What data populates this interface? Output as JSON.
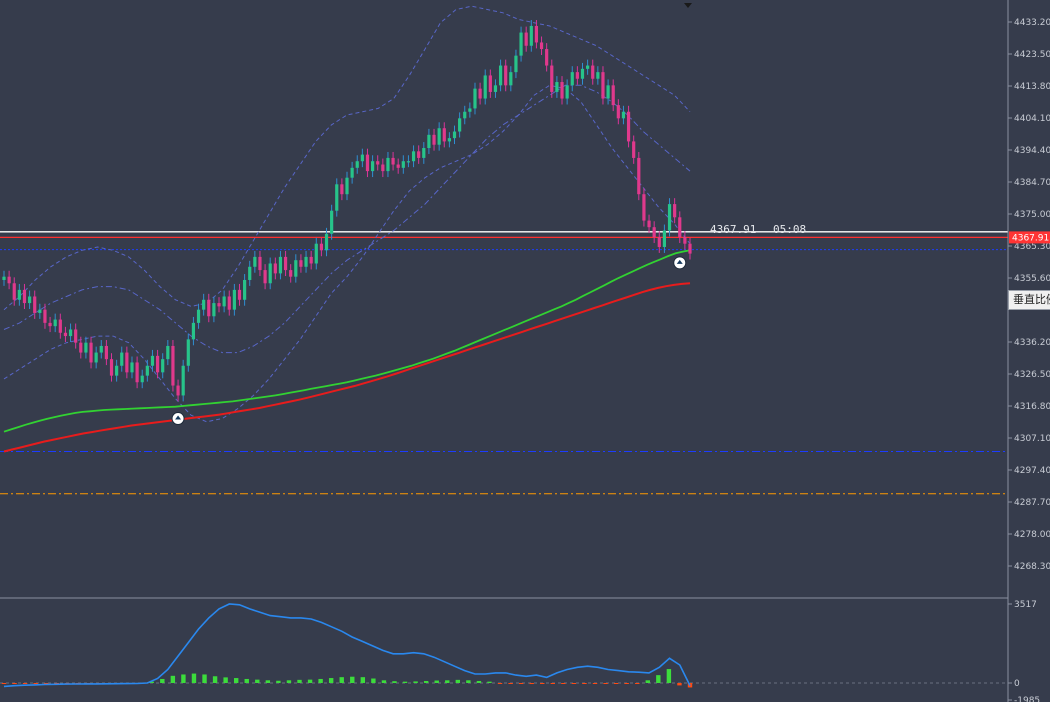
{
  "chart_data": [
    {
      "type": "candlestick",
      "panel": "main",
      "y_axis_ticks": [
        4433.2,
        4423.5,
        4413.8,
        4404.1,
        4394.4,
        4384.7,
        4375.0,
        4365.3,
        4355.6,
        4336.2,
        4326.5,
        4316.8,
        4307.1,
        4297.4,
        4287.7,
        4278.0,
        4268.3
      ],
      "ylim": [
        4262.0,
        4438.0
      ],
      "current_price": "4367.91",
      "current_price_tag": "4367.91",
      "countdown": "05:08",
      "close": [
        4356,
        4354,
        4349,
        4352,
        4348,
        4350,
        4345,
        4346,
        4342,
        4341,
        4343,
        4339,
        4338,
        4340,
        4336,
        4333,
        4336,
        4330,
        4333,
        4335,
        4331,
        4326,
        4329,
        4333,
        4327,
        4330,
        4324,
        4326,
        4329,
        4332,
        4327,
        4331,
        4335,
        4323,
        4320,
        4329,
        4337,
        4342,
        4346,
        4349,
        4344,
        4348,
        4347,
        4350,
        4346,
        4352,
        4349,
        4355,
        4359,
        4362,
        4358,
        4354,
        4360,
        4357,
        4362,
        4358,
        4356,
        4361,
        4359,
        4362,
        4360,
        4366,
        4364,
        4369,
        4376,
        4384,
        4381,
        4386,
        4389,
        4391,
        4393,
        4388,
        4391,
        4390,
        4388,
        4392,
        4390,
        4389,
        4391,
        4391,
        4394,
        4392,
        4395,
        4399,
        4396,
        4401,
        4397,
        4398,
        4400,
        4404,
        4406,
        4407,
        4413,
        4410,
        4417,
        4412,
        4414,
        4420,
        4414,
        4418,
        4423,
        4430,
        4426,
        4432,
        4427,
        4425,
        4420,
        4412,
        4415,
        4410,
        4414,
        4418,
        4416,
        4419,
        4420,
        4416,
        4418,
        4410,
        4414,
        4408,
        4404,
        4406,
        4397,
        4392,
        4381,
        4373,
        4371,
        4368,
        4365,
        4370,
        4378,
        4374,
        4368,
        4366,
        4363
      ],
      "sma_green": [
        4309,
        4309.7,
        4310.4,
        4311.1,
        4311.7,
        4312.3,
        4312.9,
        4313.4,
        4313.9,
        4314.3,
        4314.7,
        4315.0,
        4315.2,
        4315.4,
        4315.6,
        4315.7,
        4315.8,
        4315.9,
        4316.0,
        4316.1,
        4316.2,
        4316.3,
        4316.4,
        4316.5,
        4316.6,
        4316.8,
        4317.0,
        4317.2,
        4317.4,
        4317.6,
        4317.8,
        4318.0,
        4318.2,
        4318.5,
        4318.8,
        4319.1,
        4319.4,
        4319.7,
        4320.0,
        4320.4,
        4320.8,
        4321.2,
        4321.6,
        4322.0,
        4322.4,
        4322.8,
        4323.2,
        4323.6,
        4324.0,
        4324.5,
        4325.0,
        4325.5,
        4326.0,
        4326.6,
        4327.2,
        4327.8,
        4328.4,
        4329.0,
        4329.7,
        4330.4,
        4331.1,
        4331.9,
        4332.7,
        4333.5,
        4334.4,
        4335.3,
        4336.2,
        4337.1,
        4338.0,
        4338.9,
        4339.8,
        4340.7,
        4341.6,
        4342.5,
        4343.4,
        4344.3,
        4345.2,
        4346.1,
        4347.0,
        4348.0,
        4349.0,
        4350.1,
        4351.2,
        4352.3,
        4353.4,
        4354.5,
        4355.6,
        4356.6,
        4357.6,
        4358.6,
        4359.6,
        4360.5,
        4361.4,
        4362.3,
        4363.1,
        4363.6,
        4364.0
      ],
      "sma_red": [
        4303,
        4303.6,
        4304.2,
        4304.8,
        4305.4,
        4306.0,
        4306.5,
        4307.0,
        4307.5,
        4308.0,
        4308.5,
        4308.9,
        4309.3,
        4309.7,
        4310.1,
        4310.5,
        4310.9,
        4311.2,
        4311.5,
        4311.8,
        4312.1,
        4312.4,
        4312.7,
        4313.0,
        4313.3,
        4313.6,
        4313.9,
        4314.2,
        4314.6,
        4315.0,
        4315.4,
        4315.8,
        4316.2,
        4316.7,
        4317.2,
        4317.7,
        4318.2,
        4318.7,
        4319.3,
        4319.9,
        4320.5,
        4321.1,
        4321.7,
        4322.3,
        4322.9,
        4323.6,
        4324.3,
        4325.0,
        4325.7,
        4326.5,
        4327.3,
        4328.1,
        4328.9,
        4329.7,
        4330.5,
        4331.3,
        4332.1,
        4332.9,
        4333.7,
        4334.5,
        4335.3,
        4336.1,
        4336.9,
        4337.7,
        4338.5,
        4339.3,
        4340.1,
        4340.9,
        4341.7,
        4342.5,
        4343.3,
        4344.1,
        4344.9,
        4345.7,
        4346.5,
        4347.3,
        4348.1,
        4348.9,
        4349.7,
        4350.5,
        4351.3,
        4352.0,
        4352.6,
        4353.1,
        4353.5,
        4353.8,
        4354.0
      ],
      "bb_upper": [
        4346,
        4350,
        4355,
        4359,
        4362,
        4364,
        4365,
        4364,
        4362,
        4358,
        4353,
        4349,
        4347,
        4348,
        4352,
        4359,
        4367,
        4375,
        4383,
        4390,
        4397,
        4402,
        4405,
        4406,
        4407,
        4410,
        4417,
        4425,
        4433,
        4437,
        4438,
        4437,
        4436,
        4434,
        4433,
        4432,
        4430,
        4428,
        4426,
        4423,
        4420,
        4417,
        4414,
        4411,
        4406
      ],
      "bb_middle": [
        4340,
        4342,
        4345,
        4348,
        4350,
        4352,
        4353,
        4353,
        4352,
        4349,
        4346,
        4342,
        4338,
        4335,
        4333,
        4333,
        4335,
        4338,
        4342,
        4347,
        4352,
        4357,
        4361,
        4364,
        4367,
        4370,
        4374,
        4378,
        4383,
        4388,
        4393,
        4398,
        4402,
        4405,
        4408,
        4411,
        4414,
        4414,
        4412,
        4409,
        4405,
        4400,
        4396,
        4392,
        4388
      ],
      "bb_lower": [
        4325,
        4328,
        4331,
        4334,
        4336,
        4337,
        4338,
        4338,
        4336,
        4331,
        4325,
        4319,
        4314,
        4312,
        4313,
        4316,
        4320,
        4325,
        4331,
        4337,
        4344,
        4351,
        4356,
        4362,
        4369,
        4376,
        4382,
        4386,
        4389,
        4391,
        4393,
        4396,
        4400,
        4405,
        4411,
        4414,
        4413,
        4409,
        4402,
        4395,
        4389,
        4383,
        4377,
        4372,
        4366
      ],
      "h_lines": [
        {
          "y": 4367.91,
          "color": "#ff3030",
          "style": "solid"
        },
        {
          "y": 4369.6,
          "color": "#ffffff",
          "style": "solid"
        },
        {
          "y": 4364.2,
          "color": "#1c3cff",
          "style": "dotted"
        },
        {
          "y": 4303.0,
          "color": "#1c3cff",
          "style": "dash-dot"
        },
        {
          "y": 4290.2,
          "color": "#ff9900",
          "style": "dash-dot"
        }
      ],
      "signals": [
        {
          "bar": 34,
          "price": 4313.0
        },
        {
          "bar": 132,
          "price": 4360.2
        }
      ]
    },
    {
      "type": "bar-line",
      "panel": "indicator",
      "y_axis_ticks": [
        "3517",
        "0",
        "-1985"
      ],
      "ylim": [
        -1985,
        3517
      ],
      "line_values": [
        -400,
        -320,
        -260,
        -220,
        -180,
        -150,
        -130,
        -120,
        -110,
        -100,
        -90,
        -80,
        -70,
        -60,
        0,
        200,
        600,
        1200,
        1800,
        2400,
        2900,
        3300,
        3517,
        3480,
        3300,
        3150,
        3000,
        2950,
        2900,
        2900,
        2850,
        2700,
        2500,
        2300,
        2050,
        1850,
        1650,
        1450,
        1300,
        1300,
        1350,
        1300,
        1150,
        950,
        750,
        550,
        400,
        400,
        450,
        450,
        350,
        300,
        350,
        250,
        450,
        600,
        700,
        750,
        700,
        600,
        550,
        500,
        480,
        450,
        700,
        1100,
        800,
        -300
      ],
      "histogram": [
        -30,
        -50,
        -20,
        -40,
        -60,
        -30,
        -20,
        -80,
        -50,
        -120,
        -60,
        -40,
        -30,
        -20,
        60,
        180,
        320,
        380,
        420,
        380,
        300,
        250,
        220,
        180,
        150,
        120,
        100,
        120,
        140,
        150,
        180,
        220,
        260,
        280,
        260,
        200,
        120,
        80,
        60,
        70,
        90,
        110,
        120,
        140,
        120,
        90,
        60,
        -30,
        -60,
        -80,
        -120,
        -90,
        -60,
        -40,
        -30,
        -50,
        -60,
        -80,
        -40,
        -20,
        -10,
        120,
        350,
        620,
        -280,
        -520
      ]
    }
  ],
  "ui": {
    "scale_toggle_label": "垂直比例"
  },
  "colors": {
    "background": "#363c4c",
    "bull_body": "#27c48a",
    "bear_body": "#e0398c",
    "wick_bull": "#2f8fd2",
    "wick_bear": "#d9349a",
    "sma_green": "#32d232",
    "sma_red": "#e81c1c",
    "bollinger": "#5866c8",
    "indicator_line": "#2a88ee",
    "hist_positive": "#3cdc3c",
    "hist_negative": "#ff4a12",
    "axis_text": "#c8ccd4",
    "price_tag": "#ff3434"
  }
}
